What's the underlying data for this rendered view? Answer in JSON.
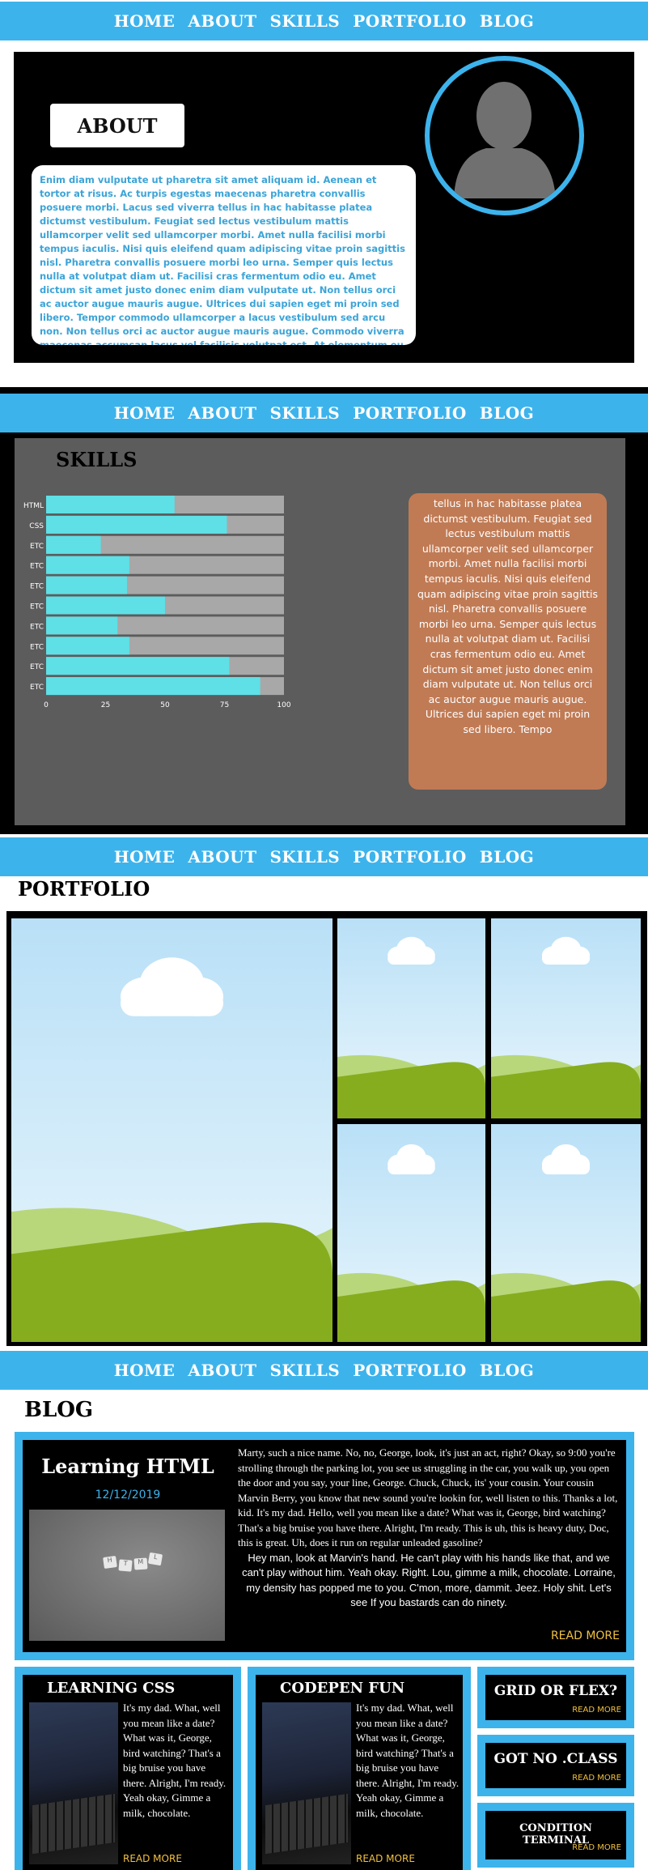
{
  "nav": {
    "items": [
      "HOME",
      "ABOUT",
      "SKILLS",
      "PORTFOLIO",
      "BLOG"
    ]
  },
  "about": {
    "title": "ABOUT",
    "text": "Enim diam vulputate ut pharetra sit amet aliquam id. Aenean et tortor at risus. Ac turpis egestas maecenas pharetra convallis posuere morbi. Lacus sed viverra tellus in hac habitasse platea dictumst vestibulum. Feugiat sed lectus vestibulum mattis ullamcorper velit sed ullamcorper morbi. Amet nulla facilisi morbi tempus iaculis. Nisi quis eleifend quam adipiscing vitae proin sagittis nisl. Pharetra convallis posuere morbi leo urna. Semper quis lectus nulla at volutpat diam ut. Facilisi cras fermentum odio eu. Amet dictum sit amet justo donec enim diam vulputate ut. Non tellus orci ac auctor augue mauris augue. Ultrices dui sapien eget mi proin sed libero. Tempor commodo ullamcorper a lacus vestibulum sed arcu non. Non tellus orci ac auctor augue mauris augue. Commodo viverra maecenas accumsan lacus vel facilisis volutpat est. At elementum eu facilisis sed odio morbi quis."
  },
  "skills": {
    "title": "SKILLS",
    "panel_text": "tellus in hac habitasse platea dictumst vestibulum. Feugiat sed lectus vestibulum mattis ullamcorper velit sed ullamcorper morbi. Amet nulla facilisi morbi tempus iaculis. Nisi quis eleifend quam adipiscing vitae proin sagittis nisl. Pharetra convallis posuere morbi leo urna. Semper quis lectus nulla at volutpat diam ut. Facilisi cras fermentum odio eu. Amet dictum sit amet justo donec enim diam vulputate ut. Non tellus orci ac auctor augue mauris augue. Ultrices dui sapien eget mi proin sed libero. Tempo"
  },
  "chart_data": {
    "type": "bar",
    "orientation": "horizontal",
    "categories": [
      "HTML",
      "CSS",
      "ETC",
      "ETC",
      "ETC",
      "ETC",
      "ETC",
      "ETC",
      "ETC",
      "ETC"
    ],
    "values": [
      54,
      76,
      23,
      35,
      34,
      50,
      30,
      35,
      77,
      90
    ],
    "xlim": [
      0,
      100
    ],
    "xticks": [
      0,
      25,
      50,
      75,
      100
    ],
    "bar_color": "#5ee0e6",
    "track_color": "#a8a8a8"
  },
  "portfolio": {
    "title": "PORTFOLIO"
  },
  "blog": {
    "title": "BLOG",
    "main": {
      "title": "Learning HTML",
      "date": "12/12/2019",
      "tiles": [
        "H",
        "T",
        "M",
        "L"
      ],
      "serif_text": "Marty, such a nice name. No, no, George, look, it's just an act, right? Okay, so 9:00 you're strolling through the parking lot, you see us struggling in the car, you walk up, you open the door and you say, your line, George. Chuck, Chuck, its' your cousin. Your cousin Marvin Berry, you know that new sound you're lookin for, well listen to this. Thanks a lot, kid. It's my dad. Hello, well you mean like a date? What was it, George, bird watching? That's a big bruise you have there. Alright, I'm ready. This is uh, this is heavy duty, Doc, this is great. Uh, does it run on regular unleaded gasoline?",
      "sans_text": "Hey man, look at Marvin's hand. He can't play with his hands like that, and we can't play without him. Yeah okay. Right. Lou, gimme a milk, chocolate. Lorraine, my density has popped me to you. C'mon, more, dammit. Jeez. Holy shit. Let's see If you bastards can do ninety.",
      "readmore": "READ MORE"
    },
    "cards": [
      {
        "title": "LEARNING CSS",
        "text": "It's my dad. What, well you mean like a date? What was it, George, bird watching? That's a big bruise you have there. Alright, I'm ready. Yeah okay, Gimme a milk, chocolate.",
        "readmore": "READ MORE"
      },
      {
        "title": "CODEPEN FUN",
        "text": "It's my dad. What, well you mean like a date? What was it, George, bird watching? That's a big bruise you have there. Alright, I'm ready. Yeah okay, Gimme a milk, chocolate.",
        "readmore": "READ MORE"
      }
    ],
    "side": [
      {
        "title": "GRID OR FLEX?",
        "readmore": "READ MORE"
      },
      {
        "title": "GOT NO .CLASS",
        "readmore": "READ MORE"
      },
      {
        "title": "CONDITION TERMINAL",
        "readmore": "READ MORE"
      }
    ]
  },
  "colors": {
    "accent": "#3db3ec",
    "skills_bar": "#5ee0e6",
    "panel": "#c07b55",
    "readmore": "#f0c040"
  }
}
